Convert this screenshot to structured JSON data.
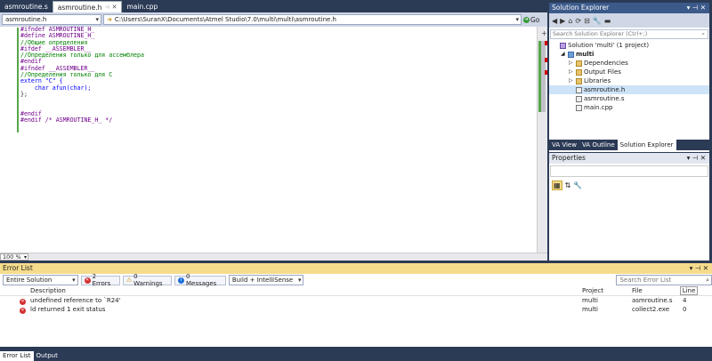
{
  "editor_tabs": [
    {
      "label": "asmroutine.s",
      "active": false
    },
    {
      "label": "asmroutine.h",
      "active": true
    },
    {
      "label": "main.cpp",
      "active": false
    }
  ],
  "nav": {
    "scope": "asmroutine.h",
    "path": "C:\\Users\\SuranX\\Documents\\Atmel Studio\\7.0\\multi\\multi\\asmroutine.h",
    "go_label": "Go"
  },
  "code_lines": [
    {
      "t": "#ifndef ASMROUTINE_H_",
      "c": "pp"
    },
    {
      "t": "#define ASMROUTINE_H_",
      "c": "pp"
    },
    {
      "t": "//Общие определения",
      "c": "cm"
    },
    {
      "t": "#ifdef __ASSEMBLER__",
      "c": "pp"
    },
    {
      "t": "//Определения только для ассемблера",
      "c": "cm"
    },
    {
      "t": "#endif",
      "c": "pp"
    },
    {
      "t": "#ifndef __ASSEMBLER__",
      "c": "pp"
    },
    {
      "t": "//Определения только для С",
      "c": "cm"
    },
    {
      "t": "extern \"C\" {",
      "c": "kw"
    },
    {
      "t": "    char afun(char);",
      "c": "kw"
    },
    {
      "t": "};",
      "c": ""
    },
    {
      "t": "",
      "c": ""
    },
    {
      "t": "",
      "c": ""
    },
    {
      "t": "#endif",
      "c": "pp"
    },
    {
      "t": "#endif /* ASMROUTINE_H_ */",
      "c": "pp"
    }
  ],
  "zoom": "100 %",
  "solution_explorer": {
    "title": "Solution Explorer",
    "search_placeholder": "Search Solution Explorer (Ctrl+;)",
    "items": [
      {
        "label": "Solution 'multi' (1 project)",
        "icon": "solution-icon",
        "indent": 0
      },
      {
        "label": "multi",
        "icon": "project-icon",
        "indent": 1,
        "bold": true
      },
      {
        "label": "Dependencies",
        "icon": "folder-icon",
        "indent": 2
      },
      {
        "label": "Output Files",
        "icon": "folder-icon",
        "indent": 2
      },
      {
        "label": "Libraries",
        "icon": "folder-icon",
        "indent": 2
      },
      {
        "label": "asmroutine.h",
        "icon": "header-file-icon",
        "indent": 2,
        "selected": true
      },
      {
        "label": "asmroutine.s",
        "icon": "asm-file-icon",
        "indent": 2
      },
      {
        "label": "main.cpp",
        "icon": "cpp-file-icon",
        "indent": 2
      }
    ],
    "tabs": [
      "VA View",
      "VA Outline",
      "Solution Explorer"
    ]
  },
  "properties": {
    "title": "Properties"
  },
  "error_list": {
    "title": "Error List",
    "scope": "Entire Solution",
    "errors_label": "2 Errors",
    "warnings_label": "0 Warnings",
    "messages_label": "0 Messages",
    "build_filter": "Build + IntelliSense",
    "search_placeholder": "Search Error List",
    "columns": [
      "Description",
      "Project",
      "File",
      "Line"
    ],
    "rows": [
      {
        "description": "undefined reference to `R24'",
        "project": "multi",
        "file": "asmroutine.s",
        "line": "4"
      },
      {
        "description": "ld returned 1 exit status",
        "project": "multi",
        "file": "collect2.exe",
        "line": "0"
      }
    ]
  },
  "bottom_tabs": [
    "Error List",
    "Output"
  ],
  "colors": {
    "accent": "#3b5a8a",
    "error": "#d32f2f",
    "warning": "#f2c000",
    "info": "#1e6fd9"
  }
}
